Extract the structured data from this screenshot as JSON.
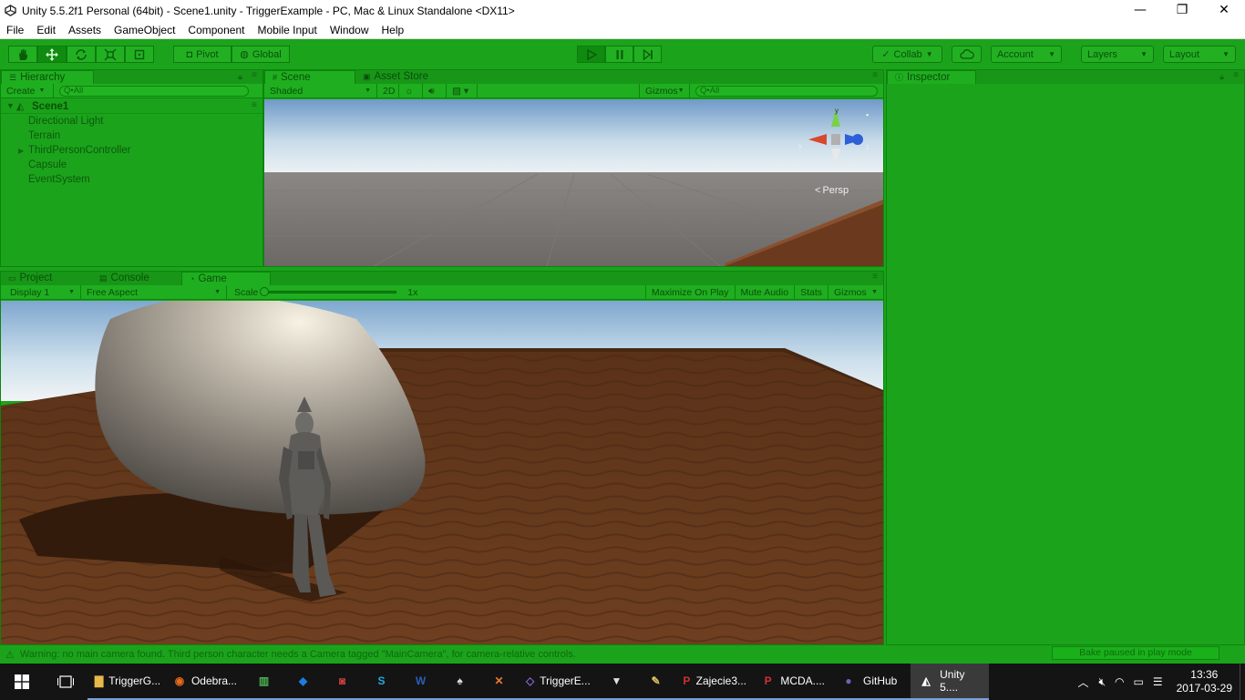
{
  "window": {
    "title": "Unity 5.5.2f1 Personal (64bit) - Scene1.unity - TriggerExample - PC, Mac & Linux Standalone <DX11>",
    "minimize": "—",
    "restore": "❐",
    "close": "✕"
  },
  "menu": [
    "File",
    "Edit",
    "Assets",
    "GameObject",
    "Component",
    "Mobile Input",
    "Window",
    "Help"
  ],
  "toolbar": {
    "pivot": "Pivot",
    "global": "Global",
    "collab": "Collab",
    "account": "Account",
    "layers": "Layers",
    "layout": "Layout"
  },
  "hierarchy": {
    "tab": "Hierarchy",
    "create": "Create",
    "search_placeholder": "Q•All",
    "scene": "Scene1",
    "items": [
      "Directional Light",
      "Terrain",
      "ThirdPersonController",
      "Capsule",
      "EventSystem"
    ]
  },
  "scene": {
    "tab": "Scene",
    "asset_store_tab": "Asset Store",
    "shading": "Shaded",
    "mode_2d": "2D",
    "gizmos": "Gizmos",
    "search_placeholder": "Q•All",
    "persp": "Persp",
    "axes": {
      "y": "y",
      "x": "x",
      "z": "z"
    }
  },
  "bottom": {
    "project_tab": "Project",
    "console_tab": "Console",
    "game_tab": "Game",
    "display": "Display 1",
    "aspect": "Free Aspect",
    "scale_label": "Scale",
    "scale_value": "1x",
    "maximize": "Maximize On Play",
    "mute": "Mute Audio",
    "stats": "Stats",
    "gizmos": "Gizmos"
  },
  "inspector": {
    "tab": "Inspector"
  },
  "status": {
    "warning": "Warning: no main camera found. Third person character needs a Camera tagged \"MainCamera\", for camera-relative controls.",
    "bake": "Bake paused in play mode"
  },
  "taskbar": {
    "items": [
      {
        "label": "TriggerG...",
        "color": "#e8b84a",
        "icon": "folder-icon"
      },
      {
        "label": "Odebra...",
        "color": "#e66a1c",
        "icon": "firefox-icon"
      },
      {
        "label": "",
        "color": "#4caf50",
        "icon": "chart-icon"
      },
      {
        "label": "",
        "color": "#1a7ee0",
        "icon": "dropbox-icon"
      },
      {
        "label": "",
        "color": "#d04040",
        "icon": "camera-icon"
      },
      {
        "label": "",
        "color": "#1faae0",
        "icon": "skype-icon"
      },
      {
        "label": "",
        "color": "#2b5fb4",
        "icon": "word-icon"
      },
      {
        "label": "",
        "color": "#dddddd",
        "icon": "cards-icon"
      },
      {
        "label": "",
        "color": "#f07830",
        "icon": "xampp-icon"
      },
      {
        "label": "TriggerE...",
        "color": "#8a5fd0",
        "icon": "visual-studio-icon"
      },
      {
        "label": "",
        "color": "#e0e0e0",
        "icon": "fox-icon"
      },
      {
        "label": "",
        "color": "#e0c060",
        "icon": "paint-icon"
      },
      {
        "label": "Zajecie3...",
        "color": "#d03030",
        "icon": "pdf-icon"
      },
      {
        "label": "MCDA....",
        "color": "#d03030",
        "icon": "pdf-icon"
      },
      {
        "label": "GitHub",
        "color": "#7a5fb4",
        "icon": "github-icon"
      },
      {
        "label": "Unity 5....",
        "color": "#ffffff",
        "icon": "unity-icon"
      }
    ],
    "time": "13:36",
    "date": "2017-03-29"
  }
}
